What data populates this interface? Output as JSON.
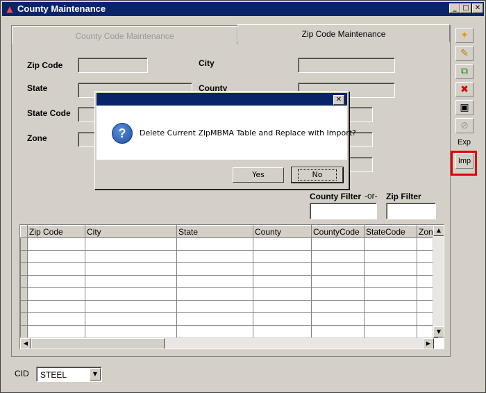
{
  "window": {
    "title": "County Maintenance"
  },
  "tabs": [
    {
      "label": "County Code Maintenance",
      "active": false
    },
    {
      "label": "Zip Code Maintenance",
      "active": true
    }
  ],
  "form": {
    "zip_code_label": "Zip Code",
    "state_label": "State",
    "state_code_label": "State Code",
    "zone_label": "Zone",
    "city_label": "City",
    "county_label": "County"
  },
  "filters": {
    "county_filter_label": "County Filter",
    "or_label": "-or-",
    "zip_filter_label": "Zip Filter"
  },
  "grid": {
    "columns": [
      "Zip Code",
      "City",
      "State",
      "County",
      "CountyCode",
      "StateCode",
      "Zon"
    ]
  },
  "toolbar": {
    "items": [
      "new-icon",
      "edit-icon",
      "copy-icon",
      "delete-icon",
      "save-icon",
      "cancel-icon"
    ],
    "exp_label": "Exp",
    "imp_label": "Imp"
  },
  "cid": {
    "label": "CID",
    "value": "STEEL"
  },
  "dialog": {
    "message": "Delete Current ZipMBMA Table and Replace with Import?",
    "yes_label": "Yes",
    "no_label": "No"
  },
  "colors": {
    "titlebar": "#0a246a",
    "highlight": "#e00000",
    "face": "#d4d0c8"
  }
}
